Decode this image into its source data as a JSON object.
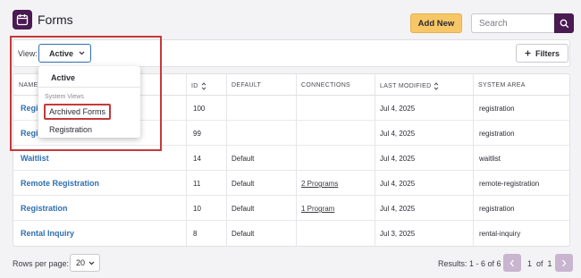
{
  "header": {
    "title": "Forms",
    "add_label": "Add New",
    "search_placeholder": "Search"
  },
  "toolbar": {
    "view_label": "View:",
    "view_value": "Active",
    "filters_label": "Filters"
  },
  "dropdown": {
    "active": "Active",
    "section": "System Views",
    "items": [
      "Archived Forms",
      "Registration"
    ]
  },
  "table": {
    "columns": [
      "NAME",
      "ID",
      "DEFAULT",
      "CONNECTIONS",
      "LAST MODIFIED",
      "SYSTEM AREA"
    ],
    "rows": [
      {
        "name": "Regis",
        "id": "100",
        "default": "",
        "connections": "",
        "modified": "Jul 4, 2025",
        "area": "registration"
      },
      {
        "name": "Regis",
        "id": "99",
        "default": "",
        "connections": "",
        "modified": "Jul 4, 2025",
        "area": "registration"
      },
      {
        "name": "Waitlist",
        "id": "14",
        "default": "Default",
        "connections": "",
        "modified": "Jul 4, 2025",
        "area": "waitlist"
      },
      {
        "name": "Remote Registration",
        "id": "11",
        "default": "Default",
        "connections": "2 Programs",
        "modified": "Jul 4, 2025",
        "area": "remote-registration"
      },
      {
        "name": "Registration",
        "id": "10",
        "default": "Default",
        "connections": "1 Program",
        "modified": "Jul 4, 2025",
        "area": "registration"
      },
      {
        "name": "Rental Inquiry",
        "id": "8",
        "default": "Default",
        "connections": "",
        "modified": "Jul 3, 2025",
        "area": "rental-inquiry"
      }
    ]
  },
  "footer": {
    "rows_label": "Rows per page:",
    "rows_value": "20",
    "results": "Results: 1 - 6 of 6",
    "page": "1",
    "of": "of",
    "total_pages": "1"
  },
  "colors": {
    "brand": "#4a1a52",
    "accent": "#f7c767",
    "link": "#2f6fb0",
    "highlight": "#c43a3a"
  }
}
